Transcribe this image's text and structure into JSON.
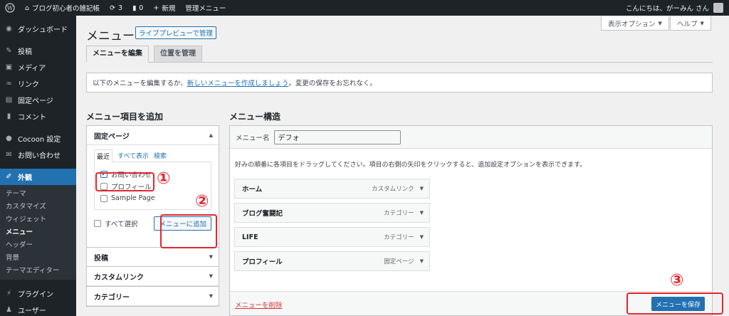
{
  "adminbar": {
    "site_name": "ブログ初心者の雑記帳",
    "updates_count": "3",
    "comments_count": "0",
    "new_label": "新規",
    "manage_menu_label": "管理メニュー",
    "greeting": "こんにちは、がーみん さん"
  },
  "sidebar": {
    "dashboard": "ダッシュボード",
    "posts": "投稿",
    "media": "メディア",
    "links": "リンク",
    "pages": "固定ページ",
    "comments": "コメント",
    "cocoon": "Cocoon 設定",
    "contact": "お問い合わせ",
    "appearance": "外観",
    "sub": [
      "テーマ",
      "カスタマイズ",
      "ウィジェット",
      "メニュー",
      "ヘッダー",
      "背景",
      "テーマエディター"
    ],
    "plugins": "プラグイン",
    "users": "ユーザー"
  },
  "screen_meta": {
    "options": "表示オプション",
    "help": "ヘルプ"
  },
  "page": {
    "title": "メニュー",
    "live_preview": "ライブプレビューで管理",
    "tab_edit": "メニューを編集",
    "tab_locations": "位置を管理"
  },
  "notice": {
    "before": "以下のメニューを編集するか、",
    "link": "新しいメニューを作成しましょう",
    "after": "。変更の保存をお忘れなく。"
  },
  "add_items": {
    "heading": "メニュー項目を追加",
    "pages_heading": "固定ページ",
    "tabs": [
      "最近",
      "すべて表示",
      "検索"
    ],
    "pages": [
      {
        "label": "お問い合わせ",
        "checked": true
      },
      {
        "label": "プロフィール",
        "checked": false
      },
      {
        "label": "Sample Page",
        "checked": false
      }
    ],
    "select_all": "すべて選択",
    "add_button": "メニューに追加",
    "posts_heading": "投稿",
    "custom_links_heading": "カスタムリンク",
    "categories_heading": "カテゴリー"
  },
  "structure": {
    "heading": "メニュー構造",
    "name_label": "メニュー名",
    "name_value": "デフォ",
    "instruction": "好みの順番に各項目をドラッグしてください。項目の右側の矢印をクリックすると、追加設定オプションを表示できます。",
    "items": [
      {
        "title": "ホーム",
        "type": "カスタムリンク"
      },
      {
        "title": "ブログ奮闘記",
        "type": "カテゴリー"
      },
      {
        "title": "LIFE",
        "type": "カテゴリー"
      },
      {
        "title": "プロフィール",
        "type": "固定ページ"
      }
    ],
    "delete_link": "メニューを削除",
    "save_button": "メニューを保存"
  },
  "annotations": {
    "n1": "①",
    "n2": "②",
    "n3": "③"
  },
  "colors": {
    "accent": "#2271b1",
    "highlight": "#e3262f",
    "adminbar": "#1d2327"
  }
}
